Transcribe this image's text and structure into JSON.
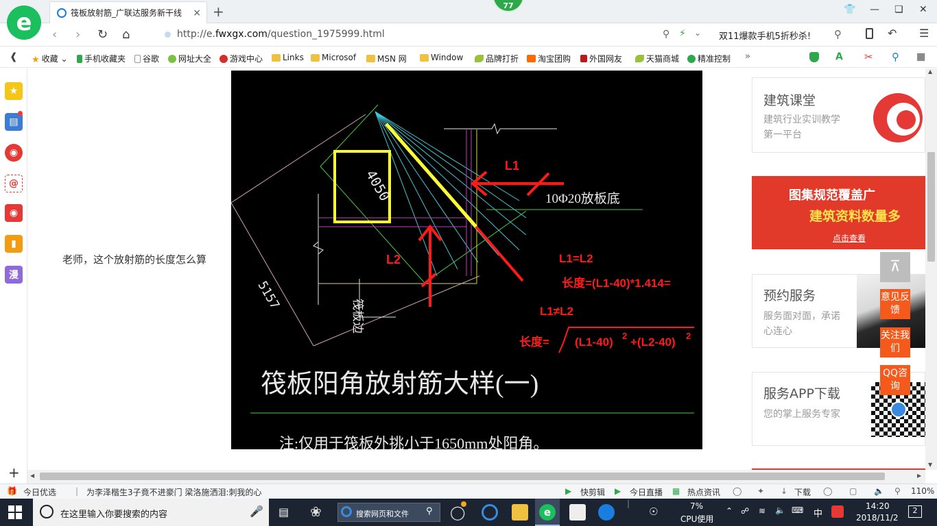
{
  "browser": {
    "tab_title": "筏板放射筋_广联达服务新干线",
    "tab_close": "×",
    "new_tab": "+",
    "badge": "77",
    "url_prefix": "http://e.",
    "url_domain": "fwxgx.com",
    "url_path": "/question_1975999.html",
    "promo_text": "双11爆款手机5折秒杀!"
  },
  "bookmarks": [
    {
      "label": "收藏",
      "icon": "star-icon"
    },
    {
      "label": "手机收藏夹",
      "icon": "phone-icon"
    },
    {
      "label": "谷歌",
      "icon": "page-icon"
    },
    {
      "label": "网址大全",
      "icon": "web-icon"
    },
    {
      "label": "游戏中心",
      "icon": "game-icon"
    },
    {
      "label": "Links",
      "icon": "folder-icon"
    },
    {
      "label": "Microsof",
      "icon": "folder-icon"
    },
    {
      "label": "MSN 网",
      "icon": "folder-icon"
    },
    {
      "label": "Window",
      "icon": "folder-icon"
    },
    {
      "label": "品牌打折",
      "icon": "leaf-icon"
    },
    {
      "label": "淘宝团购",
      "icon": "taobao-icon"
    },
    {
      "label": "外国网友",
      "icon": "flag-icon"
    },
    {
      "label": "天猫商城",
      "icon": "leaf-icon"
    },
    {
      "label": "精准控制",
      "icon": "chat-icon"
    }
  ],
  "sidebar": {
    "manga_label": "漫",
    "add_label": "+"
  },
  "content": {
    "question_text": "老师，这个放射筋的长度怎么算"
  },
  "cad": {
    "dim_4050": "4050",
    "dim_5157": "5157",
    "label_L1": "L1",
    "label_L2": "L2",
    "rebar_label": "10Φ20放板底",
    "edge_label": "筏板边",
    "eq1": "L1=L2",
    "eq2": "长度=(L1-40)*1.414=",
    "eq3": "L1≠L2",
    "eq4_prefix": "长度=",
    "eq4_body": "(L1-40)",
    "eq4_exp1": "2",
    "eq4_mid": "+(L2-40)",
    "eq4_exp2": "2",
    "title": "筏板阳角放射筋大样(一)",
    "note": "注:仅用于筏板外挑小于1650mm处阳角。"
  },
  "right_panel": {
    "card1_title": "建筑课堂",
    "card1_sub": "建筑行业实训教学第一平台",
    "banner_line1": "图集规范覆盖广",
    "banner_line2": "建筑资料数量多",
    "banner_cta": "点击查看",
    "card2_title": "预约服务",
    "card2_sub": "服务面对面，承诺心连心",
    "card3_title": "服务APP下载",
    "card3_sub": "您的掌上服务专家",
    "float_feedback": "意见反馈",
    "float_follow": "关注我们",
    "float_qq": "QQ咨询"
  },
  "statusbar": {
    "today": "今日优选",
    "news": "为李泽楷生3子竟不进豪门 梁洛施洒泪:刺我的心",
    "clip": "快剪辑",
    "live": "今日直播",
    "hot": "热点资讯",
    "download": "下载",
    "zoom": "110%"
  },
  "taskbar": {
    "search_placeholder": "在这里输入你要搜索的内容",
    "web_search": "搜索网页和文件",
    "cpu_pct": "7%",
    "cpu_label": "CPU使用",
    "ime": "中",
    "time": "14:20",
    "date": "2018/11/2",
    "notif": "2"
  },
  "colors": {
    "accent_green": "#1bbf5d",
    "float_orange": "#f35a1b",
    "cad_red": "#ff1a1a",
    "cad_yellow": "#ffff33",
    "taskbar": "#1c2431"
  }
}
